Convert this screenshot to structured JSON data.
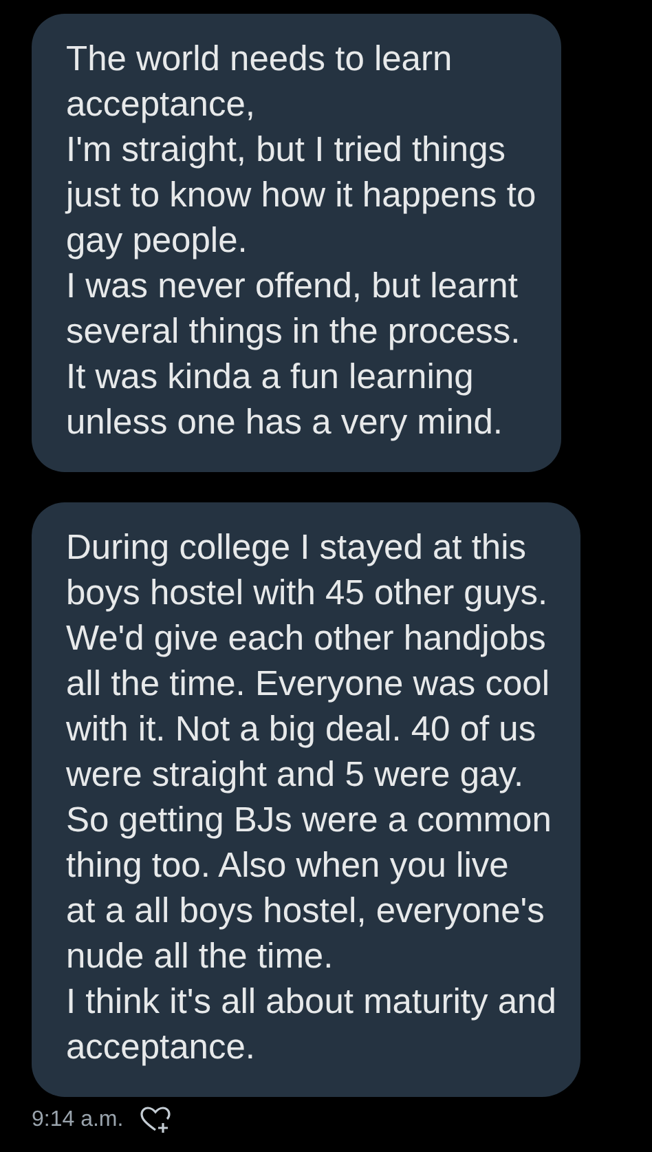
{
  "messages": [
    {
      "text": "The world needs to learn\nacceptance,\nI'm straight, but I tried things\njust to know how it happens to\ngay people.\nI was never offend, but learnt\nseveral things in the process.\nIt was kinda a fun learning\nunless one has a very mind."
    },
    {
      "text": "During college I stayed at this\nboys hostel with 45 other guys.\nWe'd give each other handjobs\nall the time. Everyone was cool\nwith it. Not a big deal. 40 of us\nwere straight and 5 were gay.\nSo getting BJs were a common\nthing too. Also when you live\nat a all boys hostel, everyone's\nnude all the time.\nI think it's all about maturity and\nacceptance."
    }
  ],
  "timestamp": "9:14 a.m."
}
